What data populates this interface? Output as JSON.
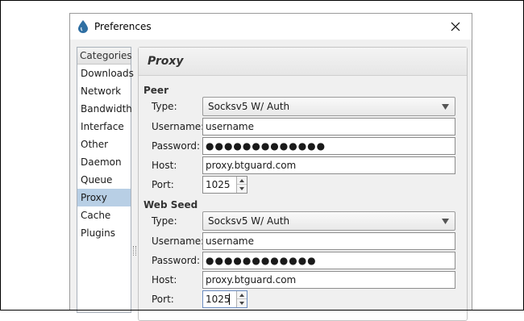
{
  "window": {
    "title": "Preferences"
  },
  "sidebar": {
    "header": "Categories",
    "items": [
      "Downloads",
      "Network",
      "Bandwidth",
      "Interface",
      "Other",
      "Daemon",
      "Queue",
      "Proxy",
      "Cache",
      "Plugins"
    ],
    "selected": "Proxy"
  },
  "panel": {
    "title": "Proxy",
    "peer": {
      "section": "Peer",
      "type_label": "Type:",
      "type_value": "Socksv5 W/ Auth",
      "username_label": "Username:",
      "username_value": "username",
      "password_label": "Password:",
      "password_value": "●●●●●●●●●●●●●",
      "host_label": "Host:",
      "host_value": "proxy.btguard.com",
      "port_label": "Port:",
      "port_value": "1025"
    },
    "webseed": {
      "section": "Web Seed",
      "type_label": "Type:",
      "type_value": "Socksv5 W/ Auth",
      "username_label": "Username:",
      "username_value": "username",
      "password_label": "Password:",
      "password_value": "●●●●●●●●●●●●",
      "host_label": "Host:",
      "host_value": "proxy.btguard.com",
      "port_label": "Port:",
      "port_value": "1025"
    }
  },
  "colors": {
    "selected_bg": "#b8cfe5",
    "window_bg": "#f0f0f0",
    "app_icon": "#2f6fa3"
  },
  "icons": {
    "app": "droplet-icon",
    "close": "close-icon",
    "dropdown": "triangle-down-icon",
    "spin_up": "arrow-up-icon",
    "spin_down": "arrow-down-icon"
  }
}
